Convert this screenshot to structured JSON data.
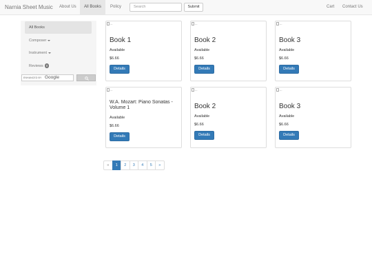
{
  "navbar": {
    "brand": "Narnia Sheet Music",
    "links": [
      "About Us",
      "All Books",
      "Policy"
    ],
    "search_placeholder": "Search",
    "submit_label": "Submit",
    "right_links": [
      "Cart",
      "Contact Us"
    ]
  },
  "sidebar": {
    "items": [
      {
        "label": "All Books"
      },
      {
        "label": "Composer"
      },
      {
        "label": "Instrument"
      },
      {
        "label": "Reviews",
        "badge": "0"
      }
    ],
    "gcse": {
      "enhanced_by": "ENHANCED BY",
      "google": "Google"
    }
  },
  "products": [
    {
      "alt": "...",
      "title": "Book 1",
      "status": "Available",
      "price": "$6.66",
      "button": "Details"
    },
    {
      "alt": "...",
      "title": "Book 2",
      "status": "Available",
      "price": "$6.66",
      "button": "Details"
    },
    {
      "alt": "...",
      "title": "Book 3",
      "status": "Available",
      "price": "$6.66",
      "button": "Details"
    },
    {
      "alt": "...",
      "title": "W.A. Mozart: Piano Sonatas - Volume 1",
      "status": "Available",
      "price": "$6.66",
      "button": "Details"
    },
    {
      "alt": "...",
      "title": "Book 2",
      "status": "Available",
      "price": "$6.66",
      "button": "Details"
    },
    {
      "alt": "...",
      "title": "Book 3",
      "status": "Available",
      "price": "$6.66",
      "button": "Details"
    }
  ],
  "pagination": {
    "prev": "«",
    "pages": [
      "1",
      "2",
      "3",
      "4",
      "5"
    ],
    "next": "»",
    "current": "1"
  },
  "colors": {
    "primary": "#337ab7",
    "navbar_bg": "#f8f8f8",
    "sidebar_bg": "#f5f5f5"
  }
}
